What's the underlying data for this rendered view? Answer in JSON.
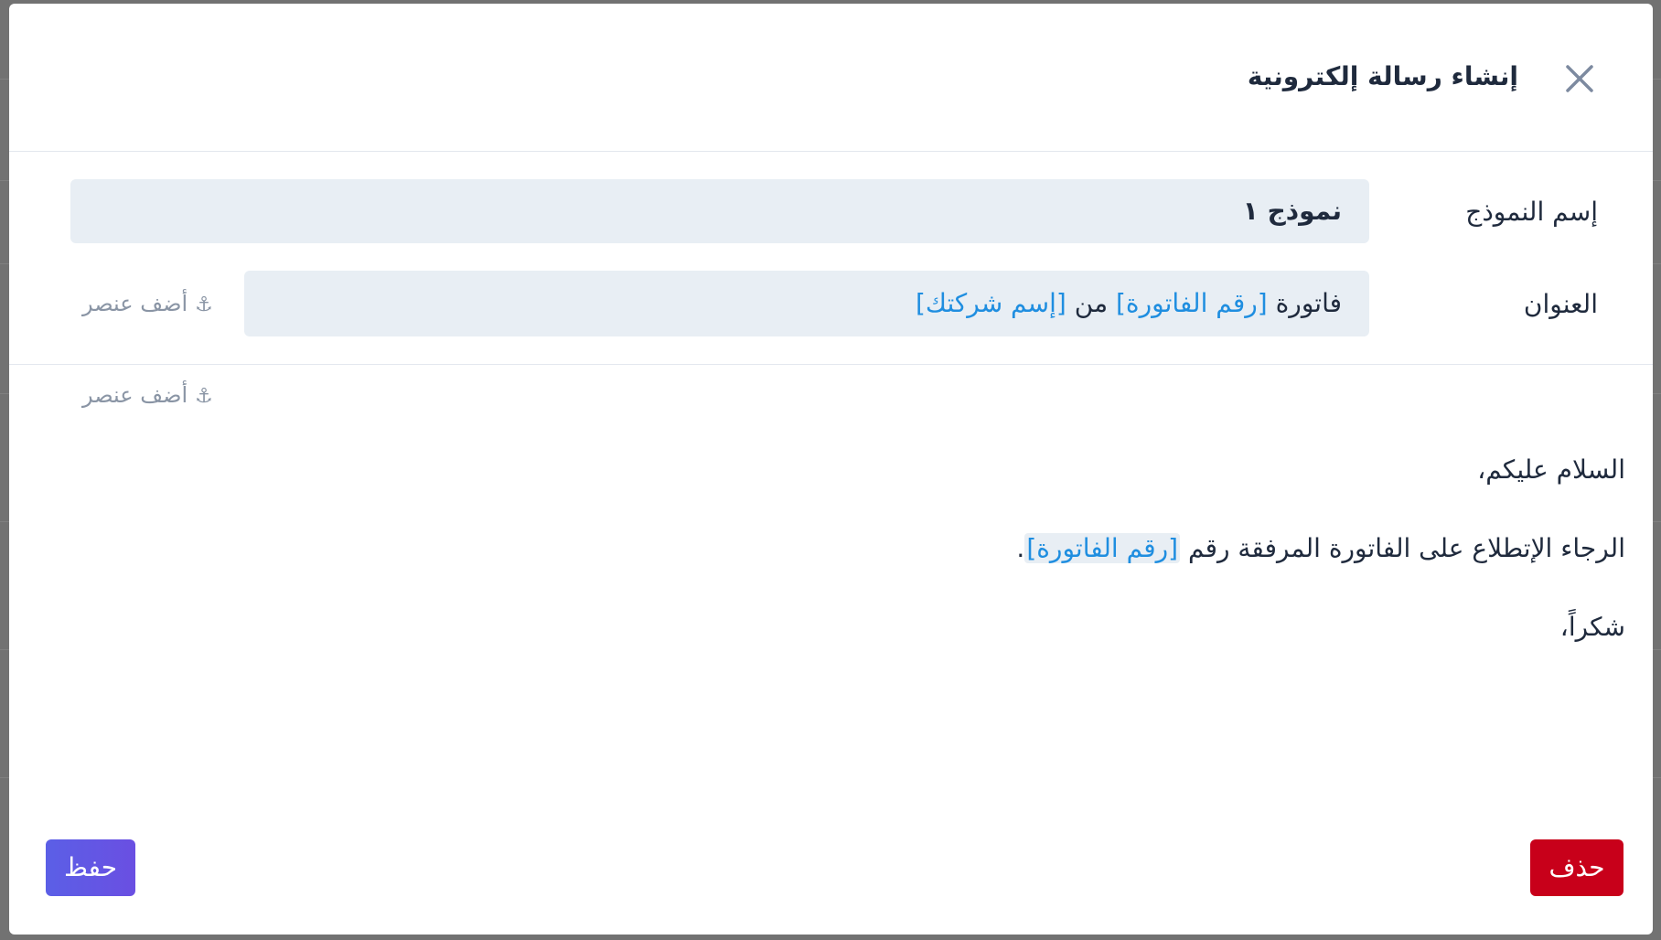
{
  "modal": {
    "title": "إنشاء رسالة إلكترونية",
    "close_icon": "close-icon"
  },
  "form": {
    "template_name": {
      "label": "إسم النموذج",
      "value": "نموذج ١"
    },
    "subject": {
      "label": "العنوان",
      "parts": [
        {
          "text": "فاتورة ",
          "is_variable": false
        },
        {
          "text": "[رقم الفاتورة]",
          "is_variable": true
        },
        {
          "text": " من ",
          "is_variable": false
        },
        {
          "text": "[إسم شركتك]",
          "is_variable": true
        }
      ]
    },
    "add_element_label": "أضف عنصر",
    "add_element_icon": "anchor-icon"
  },
  "body": {
    "greeting": "السلام عليكم،",
    "line2_prefix": "الرجاء الإتطلاع على الفاتورة المرفقة رقم ",
    "line2_variable": "[رقم الفاتورة]",
    "line2_suffix": ".",
    "closing": "شكراً،"
  },
  "actions": {
    "delete_label": "حذف",
    "save_label": "حفظ"
  },
  "colors": {
    "variable": "#1f8ee0",
    "field_bg": "#e8eef4",
    "delete": "#c8001a",
    "save": "#5b5fe6"
  }
}
